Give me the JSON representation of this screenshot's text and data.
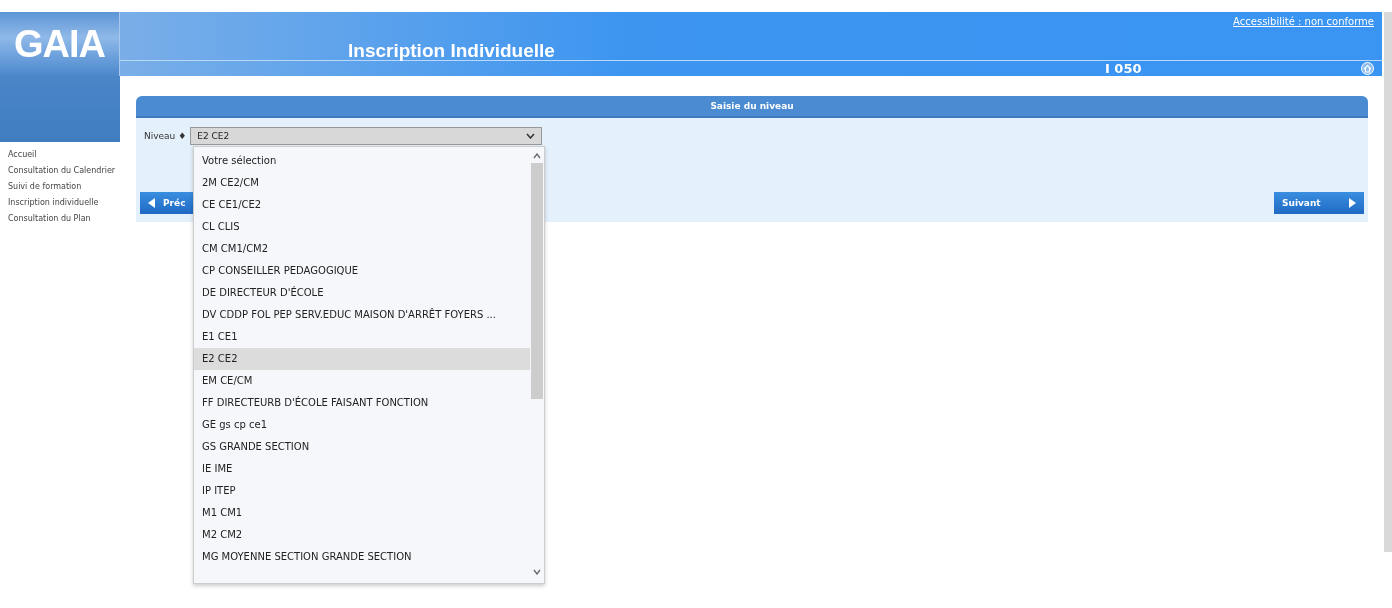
{
  "header": {
    "logo": "GAIA",
    "title": "Inscription Individuelle",
    "accessibility_link": "Accessibilité : non conforme",
    "code": "I 050"
  },
  "sidebar": {
    "items": [
      "Accueil",
      "Consultation du Calendrier",
      "Suivi de formation",
      "Inscription individuelle",
      "Consultation du Plan"
    ]
  },
  "panel": {
    "title": "Saisie du niveau",
    "field": {
      "label": "Niveau",
      "required_mark": "♦",
      "value": "E2 CE2"
    },
    "buttons": [
      {
        "label": "Préc",
        "kind": "previous"
      },
      {
        "label": "Suivant",
        "kind": "next"
      }
    ]
  },
  "dropdown": {
    "options": [
      {
        "label": "Votre sélection",
        "selected": false
      },
      {
        "label": "2M CE2/CM",
        "selected": false
      },
      {
        "label": "CE CE1/CE2",
        "selected": false
      },
      {
        "label": "CL CLIS",
        "selected": false
      },
      {
        "label": "CM CM1/CM2",
        "selected": false
      },
      {
        "label": "CP CONSEILLER PEDAGOGIQUE",
        "selected": false
      },
      {
        "label": "DE DIRECTEUR D'ÉCOLE",
        "selected": false
      },
      {
        "label": "DV CDDP FOL PEP SERV.EDUC MAISON D'ARRÊT FOYERS ...",
        "selected": false
      },
      {
        "label": "E1 CE1",
        "selected": false
      },
      {
        "label": "E2 CE2",
        "selected": true
      },
      {
        "label": "EM CE/CM",
        "selected": false
      },
      {
        "label": "FF DIRECTEURB D'ÉCOLE FAISANT FONCTION",
        "selected": false
      },
      {
        "label": "GE gs cp ce1",
        "selected": false
      },
      {
        "label": "GS GRANDE SECTION",
        "selected": false
      },
      {
        "label": "IE IME",
        "selected": false
      },
      {
        "label": "IP ITEP",
        "selected": false
      },
      {
        "label": "M1 CM1",
        "selected": false
      },
      {
        "label": "M2 CM2",
        "selected": false
      },
      {
        "label": "MG MOYENNE SECTION GRANDE SECTION",
        "selected": false
      }
    ]
  }
}
